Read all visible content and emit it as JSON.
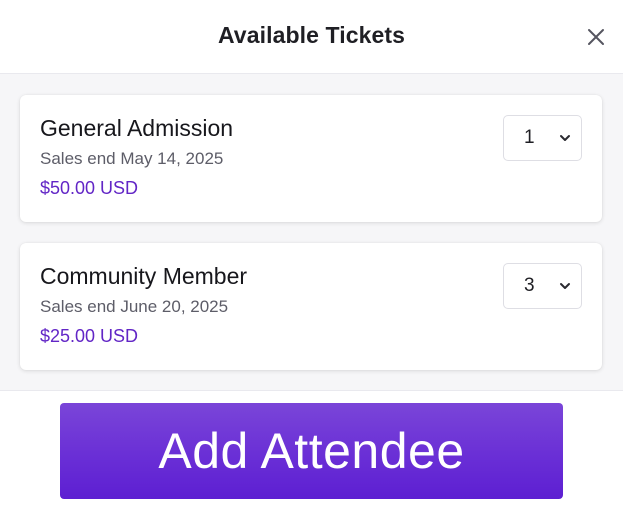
{
  "modal": {
    "title": "Available Tickets"
  },
  "tickets": [
    {
      "name": "General Admission",
      "sales_end": "Sales end May 14, 2025",
      "price": "$50.00 USD",
      "quantity": "1"
    },
    {
      "name": "Community Member",
      "sales_end": "Sales end June 20, 2025",
      "price": "$25.00 USD",
      "quantity": "3"
    }
  ],
  "footer": {
    "button_label": "Add Attendee"
  },
  "icons": {
    "close": "close-icon",
    "chevron": "chevron-down-icon"
  },
  "colors": {
    "accent": "#6a2fd6",
    "price": "#6226c6",
    "body_bg": "#f6f6f8"
  }
}
